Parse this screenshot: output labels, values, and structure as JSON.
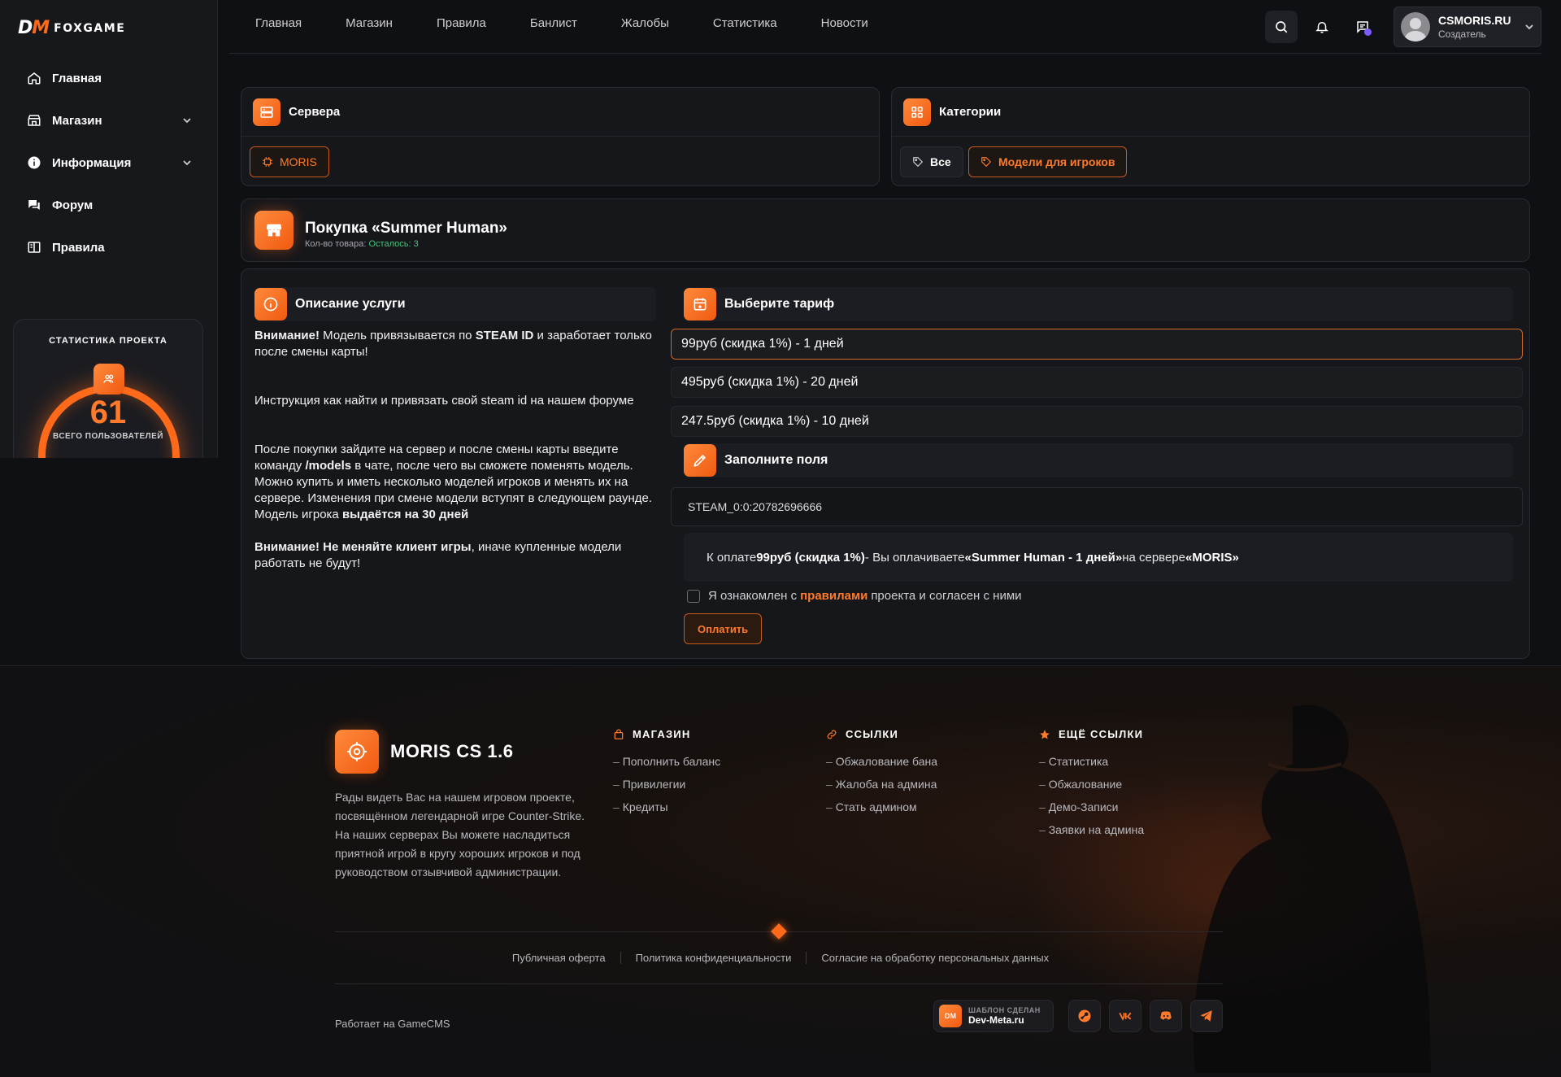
{
  "sidebar": {
    "logo_mark_a": "D",
    "logo_mark_b": "M",
    "logo_name": "FOXGAME",
    "items": [
      {
        "label": "Главная",
        "icon": "home-icon"
      },
      {
        "label": "Магазин",
        "icon": "store-icon",
        "expandable": true
      },
      {
        "label": "Информация",
        "icon": "info-icon",
        "expandable": true
      },
      {
        "label": "Форум",
        "icon": "chat-icon"
      },
      {
        "label": "Правила",
        "icon": "book-icon"
      }
    ],
    "stats": {
      "title": "СТАТИСТИКА ПРОЕКТА",
      "value": "61",
      "label": "ВСЕГО ПОЛЬЗОВАТЕЛЕЙ"
    }
  },
  "topnav": [
    "Главная",
    "Магазин",
    "Правила",
    "Банлист",
    "Жалобы",
    "Статистика",
    "Новости"
  ],
  "user": {
    "name": "CSMORIS.RU",
    "role": "Создатель"
  },
  "servers": {
    "title": "Сервера",
    "items": [
      "MORIS"
    ]
  },
  "categories": {
    "title": "Категории",
    "items": [
      "Все",
      "Модели для игроков"
    ]
  },
  "purchase": {
    "title": "Покупка «Summer Human»",
    "qty_label": "Кол-во товара:",
    "qty_value": "Осталось: 3"
  },
  "description": {
    "title": "Описание услуги",
    "p1_bold": "Внимание!",
    "p1_a": " Модель привязывается по ",
    "p1_bold2": "STEAM ID",
    "p1_b": " и заработает только после смены карты!",
    "p2": "Инструкция как найти и привязать свой steam id на нашем форуме",
    "p3_a": "После покупки зайдите на сервер и после смены карты введите команду ",
    "p3_bold": "/models",
    "p3_b": " в чате, после чего вы сможете поменять модель. Можно купить и иметь несколько моделей игроков и менять их на сервере. Изменения при смене модели вступят в следующем раунде.",
    "p4_a": "Модель игрока ",
    "p4_bold": "выдаётся на 30 дней",
    "p5_bold": "Внимание! Не меняйте клиент игры",
    "p5_b": ", иначе купленные модели работать не будут!"
  },
  "tariffs": {
    "title": "Выберите тариф",
    "items": [
      "99руб (скидка 1%) - 1 дней",
      "495руб (скидка 1%) - 20 дней",
      "247.5руб (скидка 1%) - 10 дней"
    ],
    "selected_index": 0
  },
  "fields": {
    "title": "Заполните поля",
    "steam_value": "STEAM_0:0:20782696666"
  },
  "payment": {
    "a": "К оплате ",
    "price": "99руб (скидка 1%)",
    "b": " - Вы оплачиваете ",
    "product": "«Summer Human - 1 дней»",
    "c": " на сервере ",
    "server": "«MORIS»"
  },
  "agree": {
    "a": "Я ознакомлен с",
    "link": "правилами",
    "b": "проекта и согласен с ними"
  },
  "pay_button": "Оплатить",
  "footer": {
    "brand": "MORIS CS 1.6",
    "about": "Рады видеть Вас на нашем игровом проекте, посвящённом легендарной игре Counter-Strike. На наших серверах Вы можете насладиться приятной игрой в кругу хороших игроков и под руководством отзывчивой администрации.",
    "col1": {
      "title": "МАГАЗИН",
      "links": [
        "Пополнить баланс",
        "Привилегии",
        "Кредиты"
      ]
    },
    "col2": {
      "title": "ССЫЛКИ",
      "links": [
        "Обжалование бана",
        "Жалоба на админа",
        "Стать админом"
      ]
    },
    "col3": {
      "title": "ЕЩЁ ССЫЛКИ",
      "links": [
        "Статистика",
        "Обжалование",
        "Демо-Записи",
        "Заявки на админа"
      ]
    },
    "legal": [
      "Публичная оферта",
      "Политика конфиденциальности",
      "Согласие на обработку персональных данных"
    ],
    "powered": "Работает на GameCMS",
    "devmeta_small": "ШАБЛОН СДЕЛАН",
    "devmeta_big": "Dev-Meta.ru",
    "devmeta_logo": "DM",
    "socials": [
      "steam-icon",
      "vk-icon",
      "discord-icon",
      "telegram-icon"
    ]
  },
  "colors": {
    "accent": "#ff6a1a",
    "bg": "#0f1013",
    "card": "#16171b",
    "success": "#3fc97a"
  }
}
